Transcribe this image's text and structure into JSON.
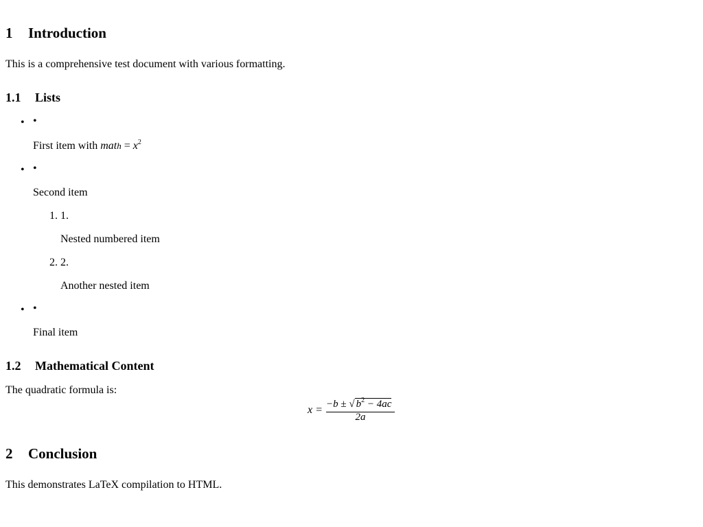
{
  "sections": [
    {
      "number": "1",
      "title": "Introduction"
    },
    {
      "number": "2",
      "title": "Conclusion"
    }
  ],
  "subsections": [
    {
      "number": "1.1",
      "title": "Lists"
    },
    {
      "number": "1.2",
      "title": "Mathematical Content"
    }
  ],
  "intro_text": "This is a comprehensive test document with various formatting.",
  "list": {
    "bullet_marker": "•",
    "item1": {
      "text": "First item with ",
      "math_var": "mat",
      "math_h": "h",
      "equals": " = ",
      "x": "x",
      "exp": "2"
    },
    "item2": {
      "text": "Second item"
    },
    "nested": [
      {
        "marker": "1. 1.",
        "text": "Nested numbered item"
      },
      {
        "marker": "2. 2.",
        "text": "Another nested item"
      }
    ],
    "item3": {
      "text": "Final item"
    }
  },
  "math_intro": "The quadratic formula is:",
  "formula": {
    "lhs": "x =",
    "minus_b": "−b",
    "pm": "±",
    "radical": "√",
    "b": "b",
    "b_exp": "2",
    "minus_4ac": "− 4ac",
    "denominator": "2a"
  },
  "conclusion_text": "This demonstrates LaTeX compilation to HTML."
}
